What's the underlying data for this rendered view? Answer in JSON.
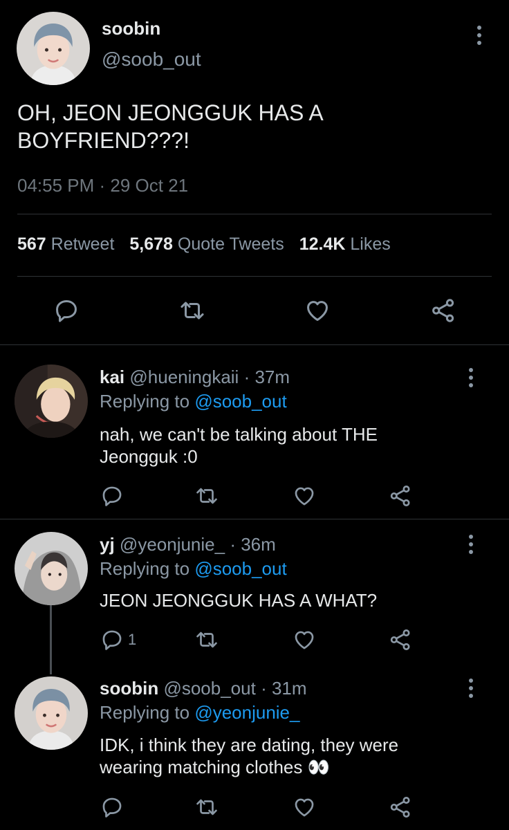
{
  "main_tweet": {
    "name": "soobin",
    "handle": "@soob_out",
    "text": "OH, JEON JEONGGUK HAS A BOYFRIEND???!",
    "timestamp": "04:55 PM · 29 Oct 21",
    "stats": {
      "retweets_count": "567",
      "retweets_label": "Retweet",
      "quotes_count": "5,678",
      "quotes_label": "Quote Tweets",
      "likes_count": "12.4K",
      "likes_label": "Likes"
    }
  },
  "replies": [
    {
      "name": "kai",
      "handle": "@hueningkaii",
      "time": "· 37m",
      "replying_prefix": "Replying to ",
      "replying_to": "@soob_out",
      "text": "nah, we can't be talking about THE Jeongguk :0",
      "reply_count": ""
    },
    {
      "name": "yj",
      "handle": "@yeonjunie_",
      "time": "· 36m",
      "replying_prefix": "Replying to ",
      "replying_to": "@soob_out",
      "text": "JEON JEONGGUK HAS A WHAT?",
      "reply_count": "1"
    },
    {
      "name": "soobin",
      "handle": "@soob_out",
      "time": "· 31m",
      "replying_prefix": "Replying to ",
      "replying_to": "@yeonjunie_",
      "text": "IDK, i think they are dating, they were wearing matching clothes 👀",
      "reply_count": ""
    }
  ],
  "icons": {
    "reply": "reply-icon",
    "retweet": "retweet-icon",
    "like": "heart-icon",
    "share": "share-icon",
    "more": "more-vertical-icon"
  },
  "colors": {
    "background": "#000000",
    "text": "#e7e9ea",
    "muted": "#8b98a5",
    "link": "#1d9bf0",
    "divider": "#2f3336"
  }
}
